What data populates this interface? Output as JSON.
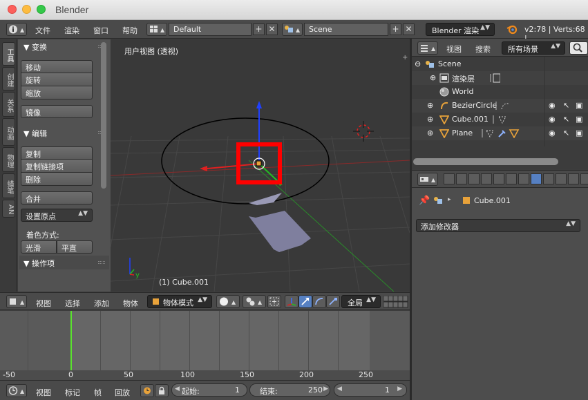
{
  "window": {
    "title": "Blender"
  },
  "info_header": {
    "menus": [
      "文件",
      "渲染",
      "窗口",
      "帮助"
    ],
    "screen_layout": "Default",
    "scene": "Scene",
    "render_engine": "Blender 渲染",
    "version_stats": "v2:78 | Verts:68 |"
  },
  "tool_shelf": {
    "tabs": [
      "工具",
      "创建",
      "关系",
      "动画",
      "物理",
      "蜡笔",
      "AN"
    ],
    "transform": {
      "header": "▼ 变换",
      "buttons": [
        "移动",
        "旋转",
        "缩放",
        "镜像"
      ]
    },
    "edit": {
      "header": "▼ 编辑",
      "buttons": [
        "复制",
        "复制链接项",
        "删除",
        "合并"
      ],
      "origin_dropdown": "设置原点"
    },
    "shading": {
      "label": "着色方式:",
      "smooth": "光滑",
      "flat": "平直"
    },
    "operator_header": "▼ 操作项"
  },
  "viewport": {
    "title": "用户视图 (透视)",
    "status": "(1) Cube.001",
    "axis_y": "y"
  },
  "viewport_header": {
    "menus": [
      "视图",
      "选择",
      "添加",
      "物体"
    ],
    "mode": "物体模式",
    "orientation": "全局"
  },
  "timeline": {
    "ruler": [
      "-50",
      "0",
      "50",
      "100",
      "150",
      "200",
      "250"
    ],
    "menus": [
      "视图",
      "标记",
      "帧",
      "回放"
    ],
    "start_label": "起始:",
    "start_value": "1",
    "end_label": "结束:",
    "end_value": "250",
    "current_frame": "1"
  },
  "outliner": {
    "menus": [
      "视图",
      "搜索"
    ],
    "filter": "所有场景",
    "rows": [
      {
        "name": "Scene"
      },
      {
        "name": "渲染层"
      },
      {
        "name": "World"
      },
      {
        "name": "BezierCircle"
      },
      {
        "name": "Cube.001"
      },
      {
        "name": "Plane"
      }
    ]
  },
  "properties": {
    "object_name": "Cube.001",
    "add_modifier": "添加修改器"
  },
  "colors": {
    "highlight_box": "#ff0000",
    "x_axis": "#e02020",
    "y_axis": "#22c022",
    "z_axis": "#2040ff",
    "current_frame": "#5ae22e",
    "active_tab": "#5680c2"
  }
}
